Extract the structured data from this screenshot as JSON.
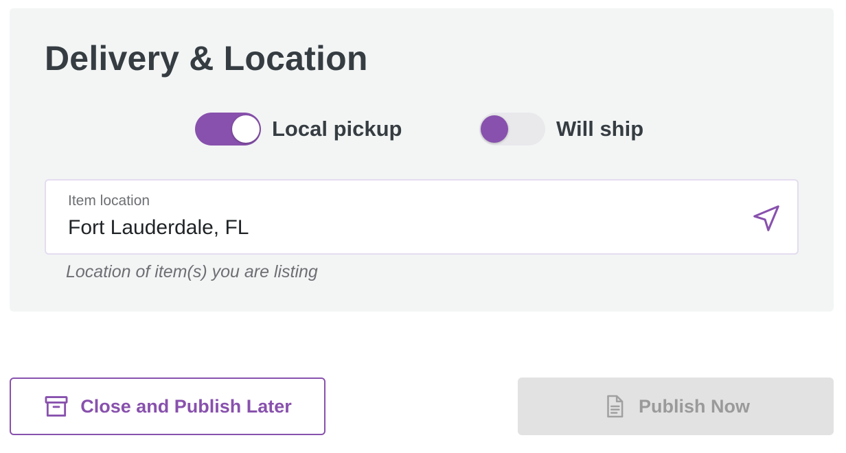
{
  "section": {
    "title": "Delivery & Location"
  },
  "toggles": {
    "local_pickup": {
      "label": "Local pickup",
      "state": "on"
    },
    "will_ship": {
      "label": "Will ship",
      "state": "off"
    }
  },
  "location_field": {
    "label": "Item location",
    "value": "Fort Lauderdale, FL",
    "helper": "Location of item(s) you are listing",
    "icon": "navigation-arrow-icon"
  },
  "actions": {
    "close_later_label": "Close and Publish Later",
    "close_later_icon": "archive-box-icon",
    "publish_now_label": "Publish Now",
    "publish_now_icon": "document-icon",
    "publish_now_disabled": true
  },
  "colors": {
    "accent": "#8851ad",
    "panel_bg": "#f3f5f5",
    "disabled_bg": "#e2e2e2",
    "disabled_text": "#9a9a9a"
  }
}
